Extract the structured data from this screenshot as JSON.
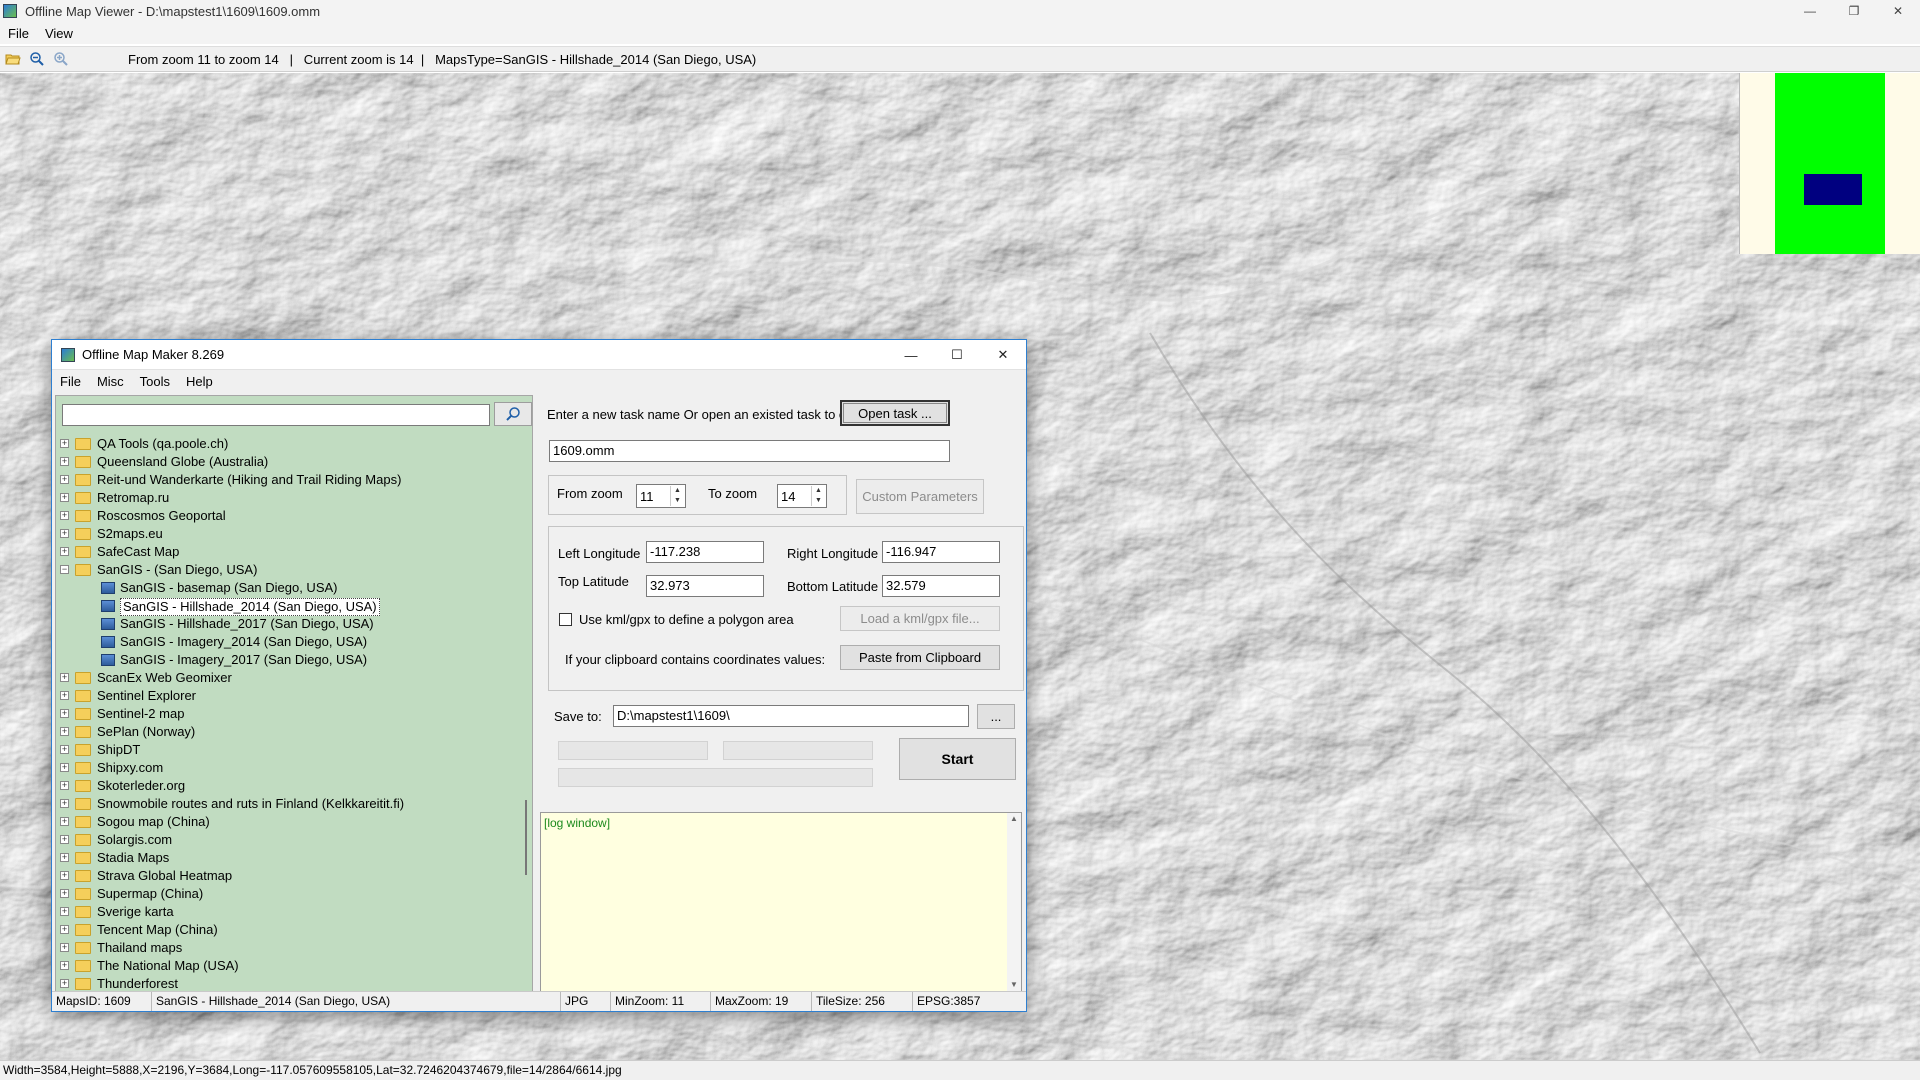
{
  "window": {
    "title": "Offline Map Viewer - D:\\mapstest1\\1609\\1609.omm",
    "controls": {
      "minimize": "—",
      "restore": "❐",
      "close": "✕"
    }
  },
  "menu": [
    "File",
    "View"
  ],
  "toolbar": {
    "info": "From zoom 11 to zoom 14   |   Current zoom is 14  |   MapsType=SanGIS - Hillshade_2014 (San Diego, USA)"
  },
  "statusbar": {
    "text": "Width=3584,Height=5888,X=2196,Y=3684,Long=-117.057609558105,Lat=32.7246204374679,file=14/2864/6614.jpg"
  },
  "dialog": {
    "title": "Offline Map Maker 8.269",
    "controls": {
      "minimize": "—",
      "maximize": "☐",
      "close": "✕"
    },
    "menu": [
      "File",
      "Misc",
      "Tools",
      "Help"
    ],
    "search": {
      "value": "",
      "placeholder": ""
    },
    "tree": [
      {
        "label": "QA Tools (qa.poole.ch)",
        "expander": "+"
      },
      {
        "label": "Queensland Globe (Australia)",
        "expander": "+"
      },
      {
        "label": "Reit-und Wanderkarte (Hiking and Trail Riding Maps)",
        "expander": "+"
      },
      {
        "label": "Retromap.ru",
        "expander": "+"
      },
      {
        "label": "Roscosmos Geoportal",
        "expander": "+"
      },
      {
        "label": "S2maps.eu",
        "expander": "+"
      },
      {
        "label": "SafeCast Map",
        "expander": "+"
      },
      {
        "label": "SanGIS - (San Diego, USA)",
        "expander": "−"
      },
      {
        "label": "SanGIS - basemap (San Diego, USA)"
      },
      {
        "label": "SanGIS - Hillshade_2014 (San Diego, USA)"
      },
      {
        "label": "SanGIS - Hillshade_2017 (San Diego, USA)"
      },
      {
        "label": "SanGIS - Imagery_2014 (San Diego, USA)"
      },
      {
        "label": "SanGIS - Imagery_2017 (San Diego, USA)"
      },
      {
        "label": "ScanEx Web Geomixer",
        "expander": "+"
      },
      {
        "label": "Sentinel Explorer",
        "expander": "+"
      },
      {
        "label": "Sentinel-2 map",
        "expander": "+"
      },
      {
        "label": "SePlan (Norway)",
        "expander": "+"
      },
      {
        "label": "ShipDT",
        "expander": "+"
      },
      {
        "label": "Shipxy.com",
        "expander": "+"
      },
      {
        "label": "Skoterleder.org",
        "expander": "+"
      },
      {
        "label": "Snowmobile routes and ruts in Finland (Kelkkareitit.fi)",
        "expander": "+"
      },
      {
        "label": "Sogou map (China)",
        "expander": "+"
      },
      {
        "label": "Solargis.com",
        "expander": "+"
      },
      {
        "label": "Stadia Maps",
        "expander": "+"
      },
      {
        "label": "Strava Global Heatmap",
        "expander": "+"
      },
      {
        "label": "Supermap (China)",
        "expander": "+"
      },
      {
        "label": "Sverige karta",
        "expander": "+"
      },
      {
        "label": "Tencent Map (China)",
        "expander": "+"
      },
      {
        "label": "Thailand maps",
        "expander": "+"
      },
      {
        "label": "The National Map (USA)",
        "expander": "+"
      },
      {
        "label": "Thunderforest",
        "expander": "+"
      }
    ],
    "task_prompt": "Enter a new task name Or open an existed task to continue:",
    "open_task_label": "Open task ...",
    "task_name": "1609.omm",
    "from_zoom_label": "From zoom",
    "from_zoom": "11",
    "to_zoom_label": "To zoom",
    "to_zoom": "14",
    "custom_params_label": "Custom Parameters",
    "left_lon_label": "Left Longitude",
    "left_lon": "-117.238",
    "right_lon_label": "Right Longitude",
    "right_lon": "-116.947",
    "top_lat_label": "Top Latitude",
    "top_lat": "32.973",
    "bottom_lat_label": "Bottom Latitude",
    "bottom_lat": "32.579",
    "kml_checkbox_label": "Use kml/gpx to define a polygon area",
    "load_kml_label": "Load a kml/gpx file...",
    "clipboard_text": "If your clipboard contains coordinates values:",
    "paste_label": "Paste from Clipboard",
    "save_to_label": "Save to:",
    "save_path": "D:\\mapstest1\\1609\\",
    "browse_label": "...",
    "start_label": "Start",
    "log_text": "[log window]",
    "status": {
      "maps_id": "MapsID: 1609",
      "map_name": "SanGIS - Hillshade_2014 (San Diego, USA)",
      "format": "JPG",
      "min_zoom": "MinZoom: 11",
      "max_zoom": "MaxZoom: 19",
      "tile_size": "TileSize: 256",
      "epsg": "EPSG:3857"
    }
  },
  "selected_index": 9,
  "colors": {
    "tree_bg": "#c1dcc1",
    "log_bg": "#ffffe0",
    "overview_green": "#00ff00",
    "overview_viewport": "#000080",
    "accent": "#2d7fd1"
  }
}
